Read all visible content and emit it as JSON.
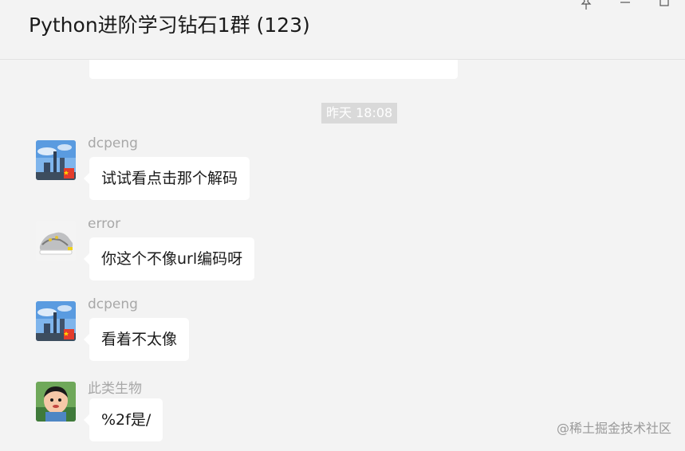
{
  "window": {
    "title": "Python进阶学习钻石1群 (123)",
    "pin_icon": "pin-icon",
    "minimize_icon": "minimize-icon",
    "maximize_icon": "maximize-icon"
  },
  "chat": {
    "partial_message": {
      "text": "…",
      "emoji_icon": "smile-emoji-icon"
    },
    "timestamp": "昨天 18:08",
    "messages": [
      {
        "sender": "dcpeng",
        "text": "试试看点击那个解码",
        "avatar": "city-skyline-avatar"
      },
      {
        "sender": "error",
        "text": "你这个不像url编码呀",
        "avatar": "sneaker-avatar"
      },
      {
        "sender": "dcpeng",
        "text": "看着不太像",
        "avatar": "city-skyline-avatar"
      },
      {
        "sender": "此类生物",
        "text": "%2f是/",
        "avatar": "cartoon-boy-avatar"
      }
    ]
  },
  "watermark": "@稀土掘金技术社区",
  "colors": {
    "background": "#f3f3f3",
    "bubble": "#ffffff",
    "sender_name": "#a8a8a8",
    "timestamp_bg": "#d9d9d9"
  }
}
